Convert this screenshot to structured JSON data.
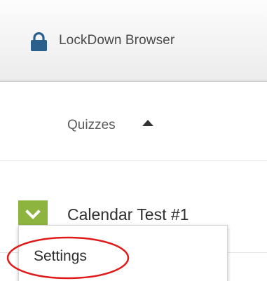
{
  "app": {
    "title": "LockDown Browser",
    "lock_icon": "lock-icon",
    "accent_color": "#2b5f8c"
  },
  "list": {
    "column_header": "Quizzes",
    "sort_icon": "sort-ascending-icon",
    "items": [
      {
        "title": "Calendar Test #1",
        "toggle_icon": "chevron-down-icon",
        "toggle_color": "#8db43e"
      }
    ]
  },
  "dropdown": {
    "items": [
      {
        "label": "Settings"
      }
    ],
    "highlight_color": "#e01919"
  }
}
